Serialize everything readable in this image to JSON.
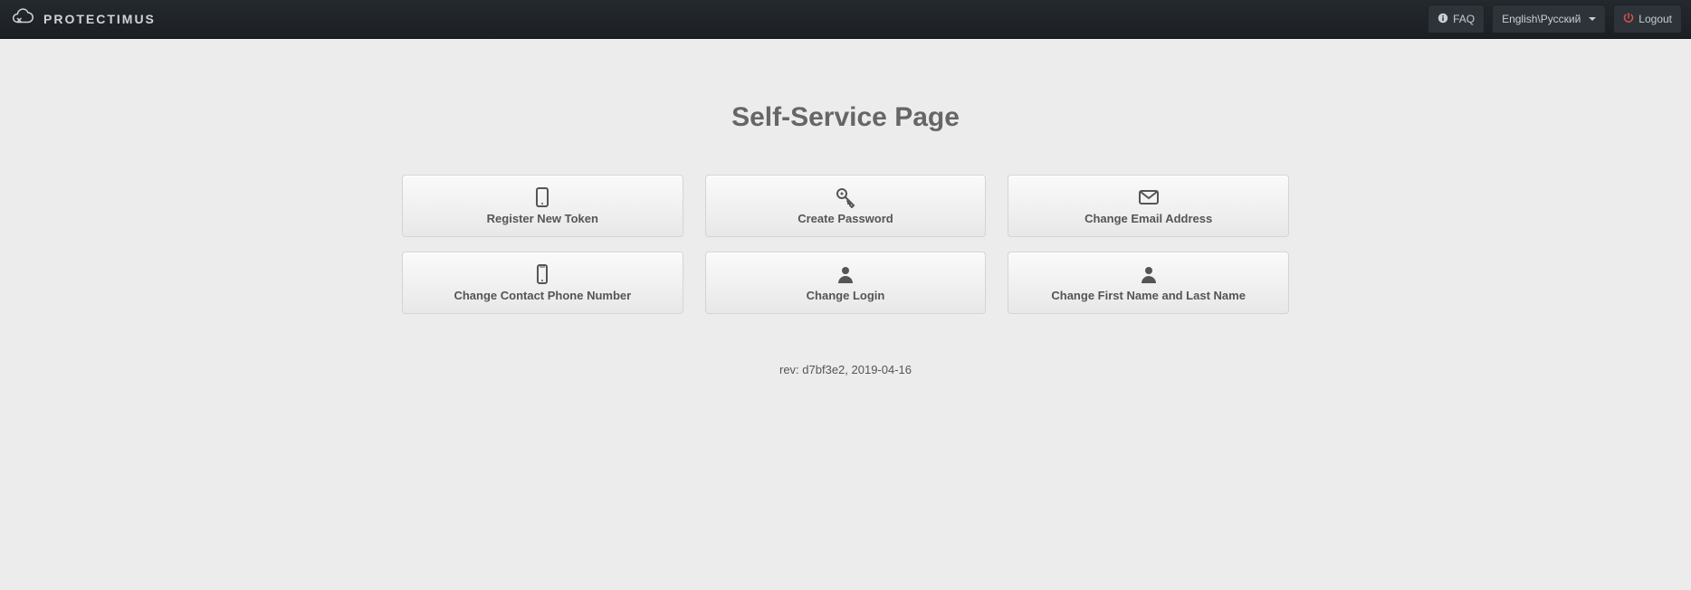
{
  "header": {
    "brand": "PROTECTIMUS",
    "faq_label": "FAQ",
    "language_label": "English\\Русский",
    "logout_label": "Logout"
  },
  "page": {
    "title": "Self-Service Page",
    "revision": "rev: d7bf3e2, 2019-04-16"
  },
  "cards": {
    "register_token": {
      "label": "Register New Token",
      "icon": "tablet-icon"
    },
    "create_password": {
      "label": "Create Password",
      "icon": "key-icon"
    },
    "change_email": {
      "label": "Change Email Address",
      "icon": "envelope-icon"
    },
    "change_phone": {
      "label": "Change Contact Phone Number",
      "icon": "phone-icon"
    },
    "change_login": {
      "label": "Change Login",
      "icon": "user-icon"
    },
    "change_name": {
      "label": "Change First Name and Last Name",
      "icon": "user-icon"
    }
  }
}
